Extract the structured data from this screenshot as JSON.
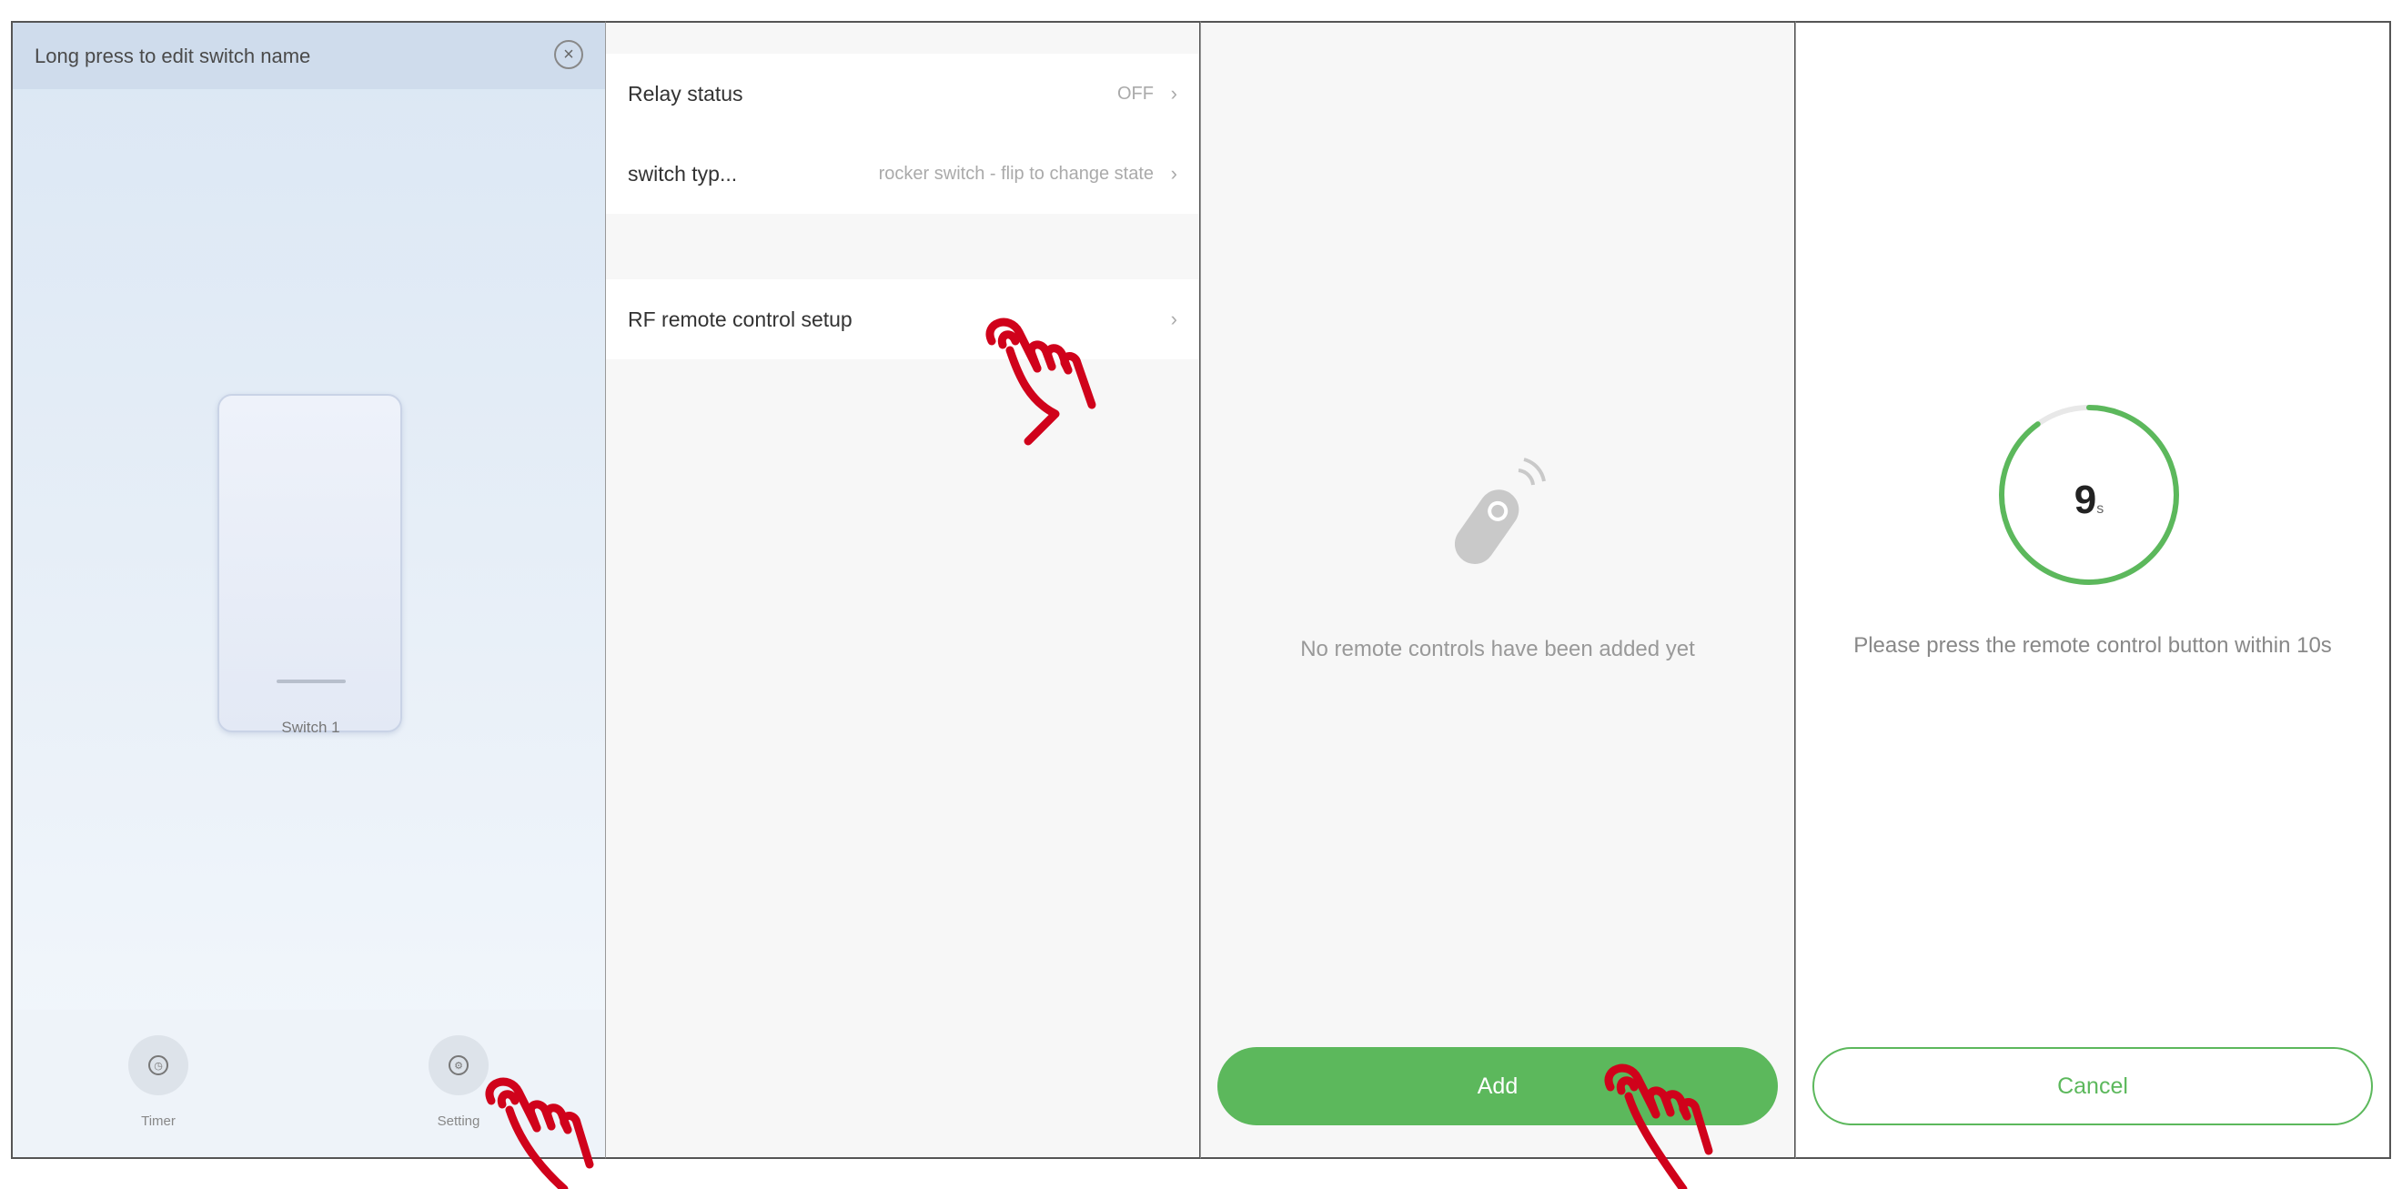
{
  "panel1": {
    "header_title": "Long press to edit switch name",
    "close_icon": "close-circle-icon",
    "switch_label": "Switch 1",
    "footer": {
      "timer_label": "Timer",
      "setting_label": "Setting"
    }
  },
  "panel2": {
    "rows": [
      {
        "label": "Relay status",
        "value": "OFF"
      },
      {
        "label": "switch typ...",
        "value": "rocker switch - flip to change state"
      }
    ],
    "rf_row": {
      "label": "RF remote control setup"
    }
  },
  "panel3": {
    "empty_message": "No remote controls have been added yet",
    "add_label": "Add",
    "icon": "remote-control-icon"
  },
  "panel4": {
    "countdown_value": "9",
    "countdown_unit": "s",
    "countdown_progress": 0.9,
    "hint": "Please press the remote control button within 10s",
    "cancel_label": "Cancel"
  },
  "colors": {
    "accent_green": "#5cb85c",
    "hand_red": "#d0021b"
  }
}
